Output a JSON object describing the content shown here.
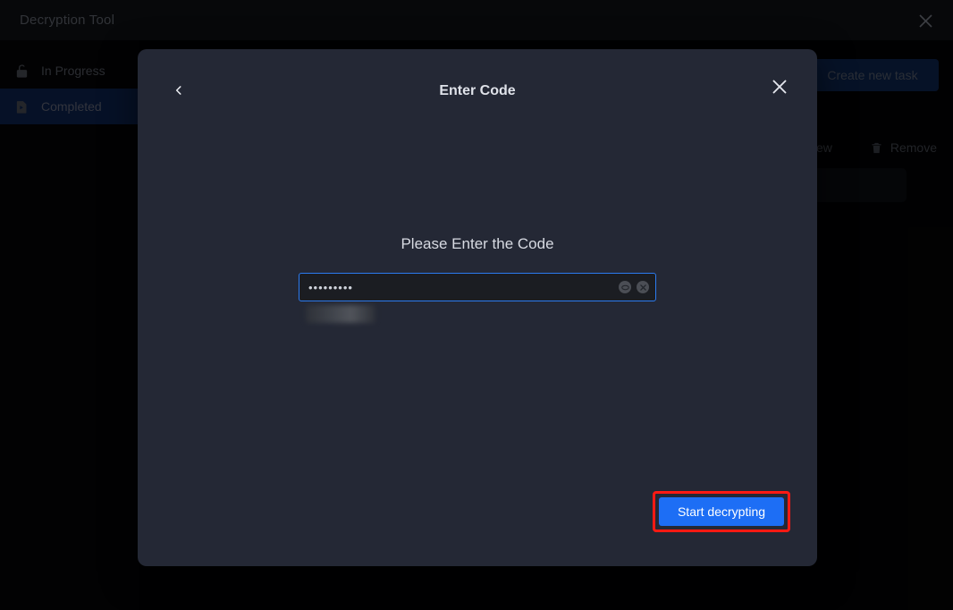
{
  "window": {
    "title": "Decryption Tool",
    "close_icon": "close-icon"
  },
  "sidebar": {
    "items": [
      {
        "label": "In Progress",
        "icon": "unlock-icon",
        "active": false
      },
      {
        "label": "Completed",
        "icon": "video-file-icon",
        "active": true
      }
    ]
  },
  "background": {
    "create_task_label": "Create new task",
    "actions": [
      {
        "label": "View",
        "icon": "eye-icon"
      },
      {
        "label": "Remove",
        "icon": "trash-icon"
      }
    ]
  },
  "modal": {
    "title": "Enter Code",
    "back_icon": "chevron-left-icon",
    "close_icon": "close-icon",
    "prompt": "Please Enter the Code",
    "input": {
      "value": "•••••••••",
      "placeholder": "",
      "reveal_icon": "eye-toggle-icon",
      "clear_icon": "clear-circle-icon"
    },
    "submit_label": "Start decrypting"
  },
  "colors": {
    "accent_blue": "#1d6ef5",
    "focus_border": "#2b7bf0",
    "highlight_red": "#ff1a13",
    "modal_bg": "#242835",
    "sidebar_active": "#0b2047"
  }
}
